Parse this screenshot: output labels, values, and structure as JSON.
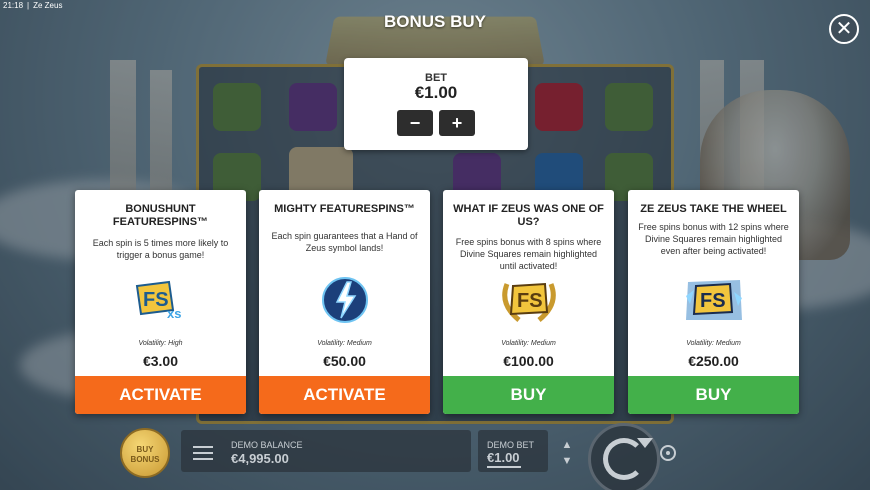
{
  "status_bar": {
    "time": "21:18",
    "game_name": "Ze Zeus"
  },
  "header": {
    "title": "BONUS BUY"
  },
  "bet_panel": {
    "label": "BET",
    "value": "€1.00",
    "minus": "−",
    "plus": "+"
  },
  "cards": [
    {
      "title": "BONUSHUNT FEATURESPINS™",
      "description": "Each spin is 5 times more likely to trigger a bonus game!",
      "icon": "fs-xs-icon",
      "volatility": "Volatility: High",
      "price": "€3.00",
      "button": "ACTIVATE",
      "button_color": "#f56a1b"
    },
    {
      "title": "MIGHTY FEATURESPINS™",
      "description": "Each spin guarantees that a Hand of Zeus symbol lands!",
      "icon": "lightning-hand-icon",
      "volatility": "Volatility: Medium",
      "price": "€50.00",
      "button": "ACTIVATE",
      "button_color": "#f56a1b"
    },
    {
      "title": "WHAT IF ZEUS WAS ONE OF US?",
      "description": "Free spins bonus with 8 spins where Divine Squares remain highlighted until activated!",
      "icon": "fs-laurel-icon",
      "volatility": "Volatility: Medium",
      "price": "€100.00",
      "button": "BUY",
      "button_color": "#43b04a"
    },
    {
      "title": "ZE ZEUS TAKE THE WHEEL",
      "description": "Free spins bonus with 12 spins where Divine Squares remain highlighted even after being activated!",
      "icon": "fs-lightning-icon",
      "volatility": "Volatility: Medium",
      "price": "€250.00",
      "button": "BUY",
      "button_color": "#43b04a"
    }
  ],
  "bottom_bar": {
    "buy_bonus_line1": "BUY",
    "buy_bonus_line2": "BONUS",
    "balance_label": "DEMO BALANCE",
    "balance_value": "€4,995.00",
    "bet_label": "DEMO BET",
    "bet_value": "€1.00"
  }
}
